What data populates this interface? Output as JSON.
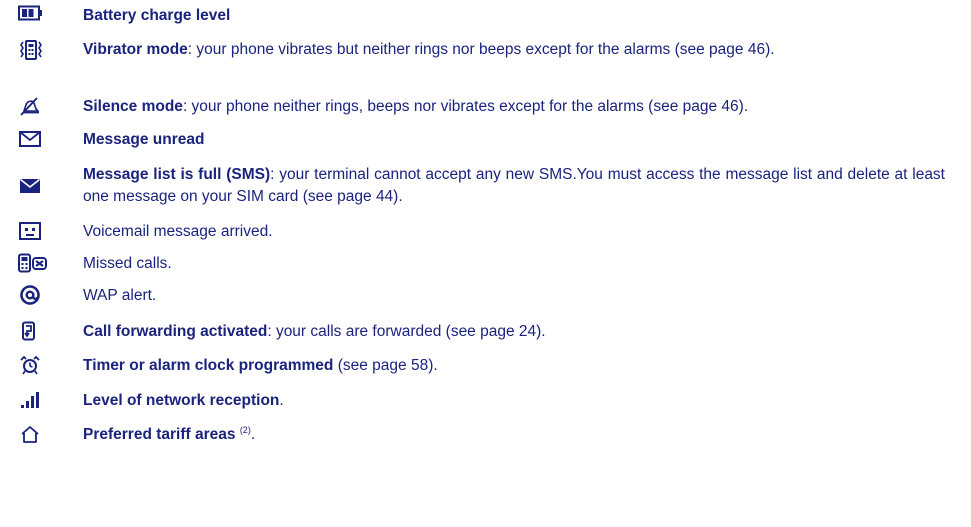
{
  "items": [
    {
      "icon": "battery-icon",
      "title": "Battery charge level",
      "rest": ""
    },
    {
      "icon": "vibrator-icon",
      "title": "Vibrator mode",
      "rest": ": your phone vibrates but neither rings nor beeps except for the alarms (see page 46)."
    },
    {
      "icon": "silence-bell-icon",
      "title": "Silence mode",
      "rest": ": your phone neither rings, beeps nor vibrates except for the alarms (see page 46)."
    },
    {
      "icon": "envelope-outline-icon",
      "title": "Message unread",
      "rest": ""
    },
    {
      "icon": "envelope-filled-icon",
      "title": "Message list is full (SMS)",
      "rest": ": your terminal cannot accept any new SMS.You must access the message list and delete at least one message on your SIM card (see page 44)."
    },
    {
      "icon": "voicemail-icon",
      "title": "",
      "rest": "Voicemail message arrived."
    },
    {
      "icon": "missed-calls-icon",
      "title": "",
      "rest": "Missed calls."
    },
    {
      "icon": "at-sign-icon",
      "title": "",
      "rest": "WAP alert."
    },
    {
      "icon": "call-forwarding-icon",
      "title": "Call forwarding activated",
      "rest": ": your calls are forwarded (see page 24)."
    },
    {
      "icon": "alarm-clock-icon",
      "title": "Timer or alarm clock programmed",
      "rest": " (see page 58)."
    },
    {
      "icon": "signal-bars-icon",
      "title": "Level of network reception",
      "rest": "."
    },
    {
      "icon": "home-icon",
      "title": "Preferred tariff areas",
      "sup": "(2)",
      "rest": "."
    }
  ]
}
